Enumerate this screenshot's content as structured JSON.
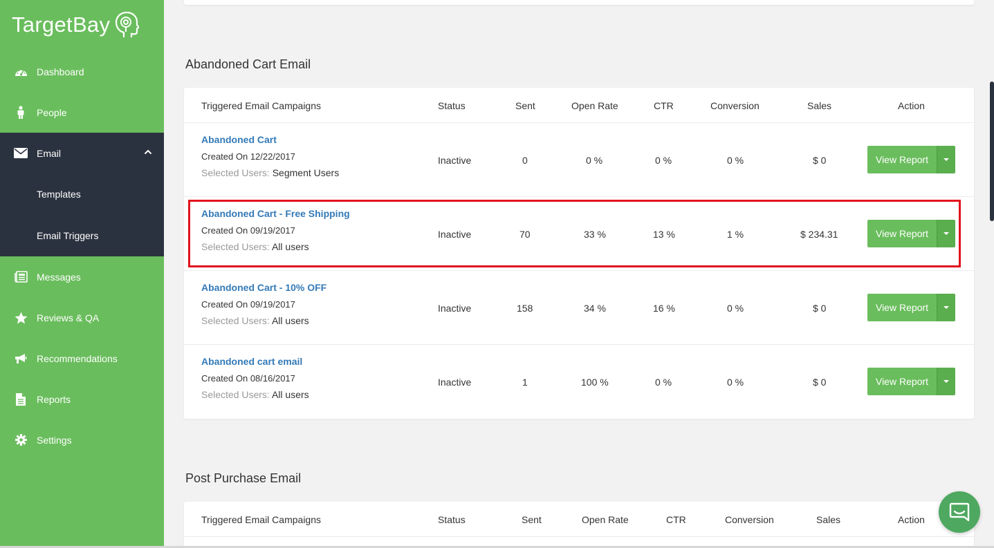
{
  "brand": {
    "name": "TargetBay"
  },
  "sidebar": {
    "items": [
      {
        "label": "Dashboard",
        "icon": "dashboard-icon"
      },
      {
        "label": "People",
        "icon": "person-icon"
      },
      {
        "label": "Email",
        "icon": "envelope-icon"
      },
      {
        "label": "Messages",
        "icon": "newspaper-icon"
      },
      {
        "label": "Reviews & QA",
        "icon": "star-icon"
      },
      {
        "label": "Recommendations",
        "icon": "megaphone-icon"
      },
      {
        "label": "Reports",
        "icon": "document-icon"
      },
      {
        "label": "Settings",
        "icon": "gear-icon"
      }
    ],
    "email_sub": [
      {
        "label": "Templates"
      },
      {
        "label": "Email Triggers"
      }
    ]
  },
  "abandoned": {
    "title": "Abandoned Cart Email",
    "headers": [
      "Triggered Email Campaigns",
      "Status",
      "Sent",
      "Open Rate",
      "CTR",
      "Conversion",
      "Sales",
      "Action"
    ],
    "rows": [
      {
        "name": "Abandoned Cart",
        "created": "Created On 12/22/2017",
        "sel_label": "Selected Users:",
        "sel_value": "Segment Users",
        "status": "Inactive",
        "sent": "0",
        "open_rate": "0 %",
        "ctr": "0 %",
        "conversion": "0 %",
        "sales": "$ 0",
        "action": "View Report"
      },
      {
        "name": "Abandoned Cart - Free Shipping",
        "created": "Created On 09/19/2017",
        "sel_label": "Selected Users:",
        "sel_value": "All users",
        "status": "Inactive",
        "sent": "70",
        "open_rate": "33 %",
        "ctr": "13 %",
        "conversion": "1 %",
        "sales": "$ 234.31",
        "action": "View Report"
      },
      {
        "name": "Abandoned Cart - 10% OFF",
        "created": "Created On 09/19/2017",
        "sel_label": "Selected Users:",
        "sel_value": "All users",
        "status": "Inactive",
        "sent": "158",
        "open_rate": "34 %",
        "ctr": "16 %",
        "conversion": "0 %",
        "sales": "$ 0",
        "action": "View Report"
      },
      {
        "name": "Abandoned cart email",
        "created": "Created On 08/16/2017",
        "sel_label": "Selected Users:",
        "sel_value": "All users",
        "status": "Inactive",
        "sent": "1",
        "open_rate": "100 %",
        "ctr": "0 %",
        "conversion": "0 %",
        "sales": "$ 0",
        "action": "View Report"
      }
    ]
  },
  "post_purchase": {
    "title": "Post Purchase Email",
    "headers": [
      "Triggered Email Campaigns",
      "Status",
      "Sent",
      "Open Rate",
      "CTR",
      "Conversion",
      "Sales",
      "Action"
    ]
  },
  "colors": {
    "sidebar_green": "#6abd5d",
    "sidebar_dark": "#2b323f",
    "link_blue": "#337ab7",
    "highlight_red": "#e0141d"
  }
}
